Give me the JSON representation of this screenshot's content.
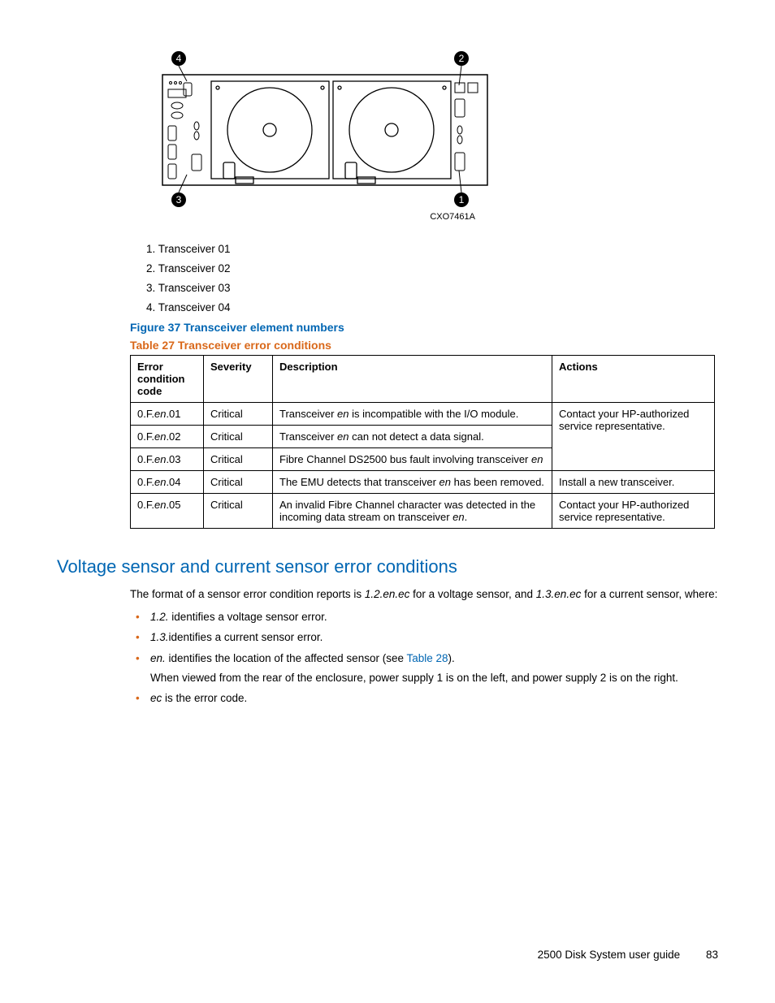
{
  "diagram": {
    "ref": "CXO7461A",
    "callouts": [
      "1",
      "2",
      "3",
      "4"
    ]
  },
  "legend": [
    "1.  Transceiver 01",
    "2.  Transceiver 02",
    "3.  Transceiver 03",
    "4.  Transceiver 04"
  ],
  "figure_caption": "Figure 37 Transceiver element numbers",
  "table_caption": "Table 27 Transceiver error conditions",
  "table": {
    "headers": [
      "Error condition code",
      "Severity",
      "Description",
      "Actions"
    ],
    "rows": [
      {
        "code_pre": "0.F.",
        "code_em": "en",
        "code_post": ".01",
        "severity": "Critical",
        "desc_pre": "Transceiver ",
        "desc_em": "en",
        "desc_post": " is incompatible with the I/O module.",
        "action": "Contact your HP-authorized service representative."
      },
      {
        "code_pre": "0.F.",
        "code_em": "en",
        "code_post": ".02",
        "severity": "Critical",
        "desc_pre": "Transceiver ",
        "desc_em": "en",
        "desc_post": " can not detect a data signal.",
        "action": ""
      },
      {
        "code_pre": "0.F.",
        "code_em": "en",
        "code_post": ".03",
        "severity": "Critical",
        "desc_pre": "Fibre Channel DS2500 bus fault involving transceiver ",
        "desc_em": "en",
        "desc_post": "",
        "action": ""
      },
      {
        "code_pre": "0.F.",
        "code_em": "en",
        "code_post": ".04",
        "severity": "Critical",
        "desc_pre": "The EMU detects that transceiver ",
        "desc_em": "en",
        "desc_post": " has been removed.",
        "action": "Install a new transceiver."
      },
      {
        "code_pre": "0.F.",
        "code_em": "en",
        "code_post": ".05",
        "severity": "Critical",
        "desc_pre": "An invalid Fibre Channel character was detected in the incoming data stream on transceiver ",
        "desc_em": "en",
        "desc_post": ".",
        "action": "Contact your HP-authorized service representative."
      }
    ]
  },
  "section_heading": "Voltage sensor and current sensor error conditions",
  "intro": {
    "pre": "The format of a sensor error condition reports is ",
    "em1": "1.2.en.ec",
    "mid": " for a voltage sensor, and ",
    "em2": "1.3.en.ec",
    "post": " for a current sensor, where:"
  },
  "bullets": [
    {
      "em": "1.2.",
      "rest": " identifies a voltage sensor error."
    },
    {
      "em": "1.3.",
      "rest": "identifies a current sensor error."
    },
    {
      "em": "en.",
      "rest": " identifies the location of the affected sensor (see ",
      "link": "Table 28",
      "tail": ").",
      "sub": "When viewed from the rear of the enclosure, power supply 1 is on the left, and power supply 2 is on the right."
    },
    {
      "em": "ec",
      "rest": " is the error code."
    }
  ],
  "footer": {
    "title": "2500 Disk System user guide",
    "page": "83"
  }
}
